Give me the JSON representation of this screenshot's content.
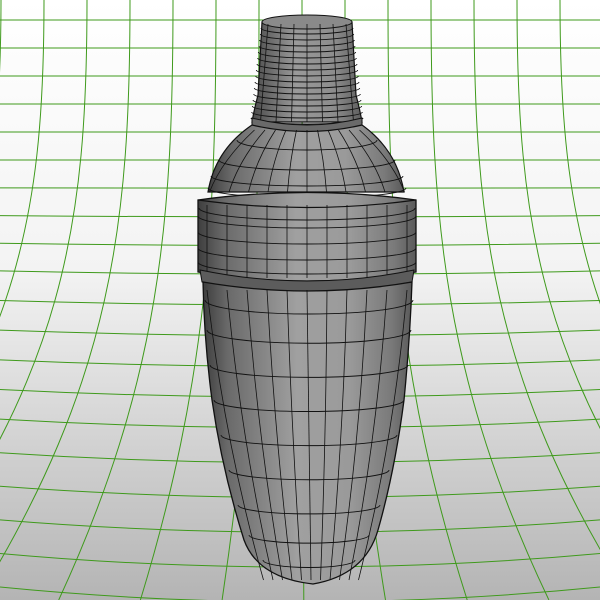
{
  "viewport": {
    "type": "3d-wireframe-render",
    "subject": "cocktail-shaker-model",
    "display_mode": "shaded-with-wireframe",
    "backdrop": "curved-grid-sweep",
    "colors": {
      "grid_line": "#3f9a1c",
      "backdrop_top": "#ffffff",
      "backdrop_bottom": "#b4b4b4",
      "model_light": "#9e9e9e",
      "model_mid": "#7f7f7f",
      "model_dark": "#3b3b3b",
      "wire": "#111111"
    }
  }
}
